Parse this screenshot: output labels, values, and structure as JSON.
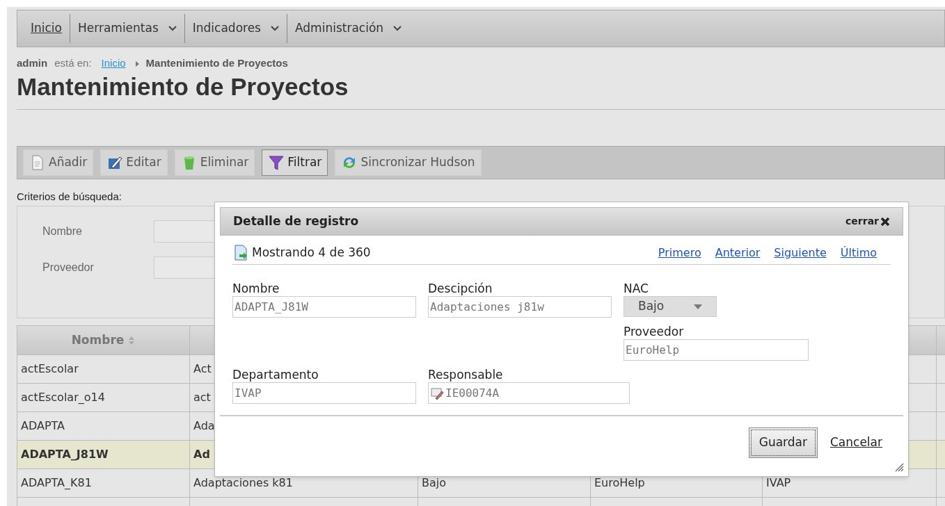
{
  "nav": [
    {
      "label": "Inicio",
      "selected": true,
      "dropdown": false
    },
    {
      "label": "Herramientas",
      "selected": false,
      "dropdown": true
    },
    {
      "label": "Indicadores",
      "selected": false,
      "dropdown": true
    },
    {
      "label": "Administración",
      "selected": false,
      "dropdown": true
    }
  ],
  "breadcrumb": {
    "user": "admin",
    "prefix": "está en:",
    "link": "Inicio",
    "current": "Mantenimiento de Proyectos"
  },
  "page_title": "Mantenimiento de Proyectos",
  "toolbar": [
    {
      "label": "Añadir",
      "kind": "add",
      "selected": false
    },
    {
      "label": "Editar",
      "kind": "edit",
      "selected": false
    },
    {
      "label": "Eliminar",
      "kind": "delete",
      "selected": false
    },
    {
      "label": "Filtrar",
      "kind": "filter",
      "selected": true
    },
    {
      "label": "Sincronizar Hudson",
      "kind": "sync",
      "selected": false
    }
  ],
  "search": {
    "title": "Criterios de búsqueda:",
    "fields": [
      "Nombre",
      "Proveedor"
    ]
  },
  "table": {
    "columns": [
      "Nombre"
    ],
    "rows": [
      {
        "selected": false,
        "cells": [
          "actEscolar",
          "Act"
        ]
      },
      {
        "selected": false,
        "cells": [
          "actEscolar_o14",
          "act"
        ]
      },
      {
        "selected": false,
        "cells": [
          "ADAPTA",
          "Ada"
        ]
      },
      {
        "selected": true,
        "cells": [
          "ADAPTA_J81W",
          "Ad"
        ]
      },
      {
        "selected": false,
        "cells": [
          "ADAPTA_K81",
          "Adaptaciones k81",
          "Bajo",
          "EuroHelp",
          "IVAP"
        ]
      }
    ]
  },
  "dialog": {
    "title": "Detalle de registro",
    "close": "cerrar",
    "position": "Mostrando 4 de 360",
    "pager": [
      "Primero",
      "Anterior",
      "Siguiente",
      "Último"
    ],
    "fields": {
      "nombre": {
        "label": "Nombre",
        "value": "ADAPTA_J81W"
      },
      "descripcion": {
        "label": "Descipción",
        "value": "Adaptaciones j81w"
      },
      "nac": {
        "label": "NAC",
        "value": "Bajo"
      },
      "proveedor": {
        "label": "Proveedor",
        "value": "EuroHelp"
      },
      "departamento": {
        "label": "Departamento",
        "value": "IVAP"
      },
      "responsable": {
        "label": "Responsable",
        "value": "IE00074A"
      }
    },
    "save": "Guardar",
    "cancel": "Cancelar"
  }
}
